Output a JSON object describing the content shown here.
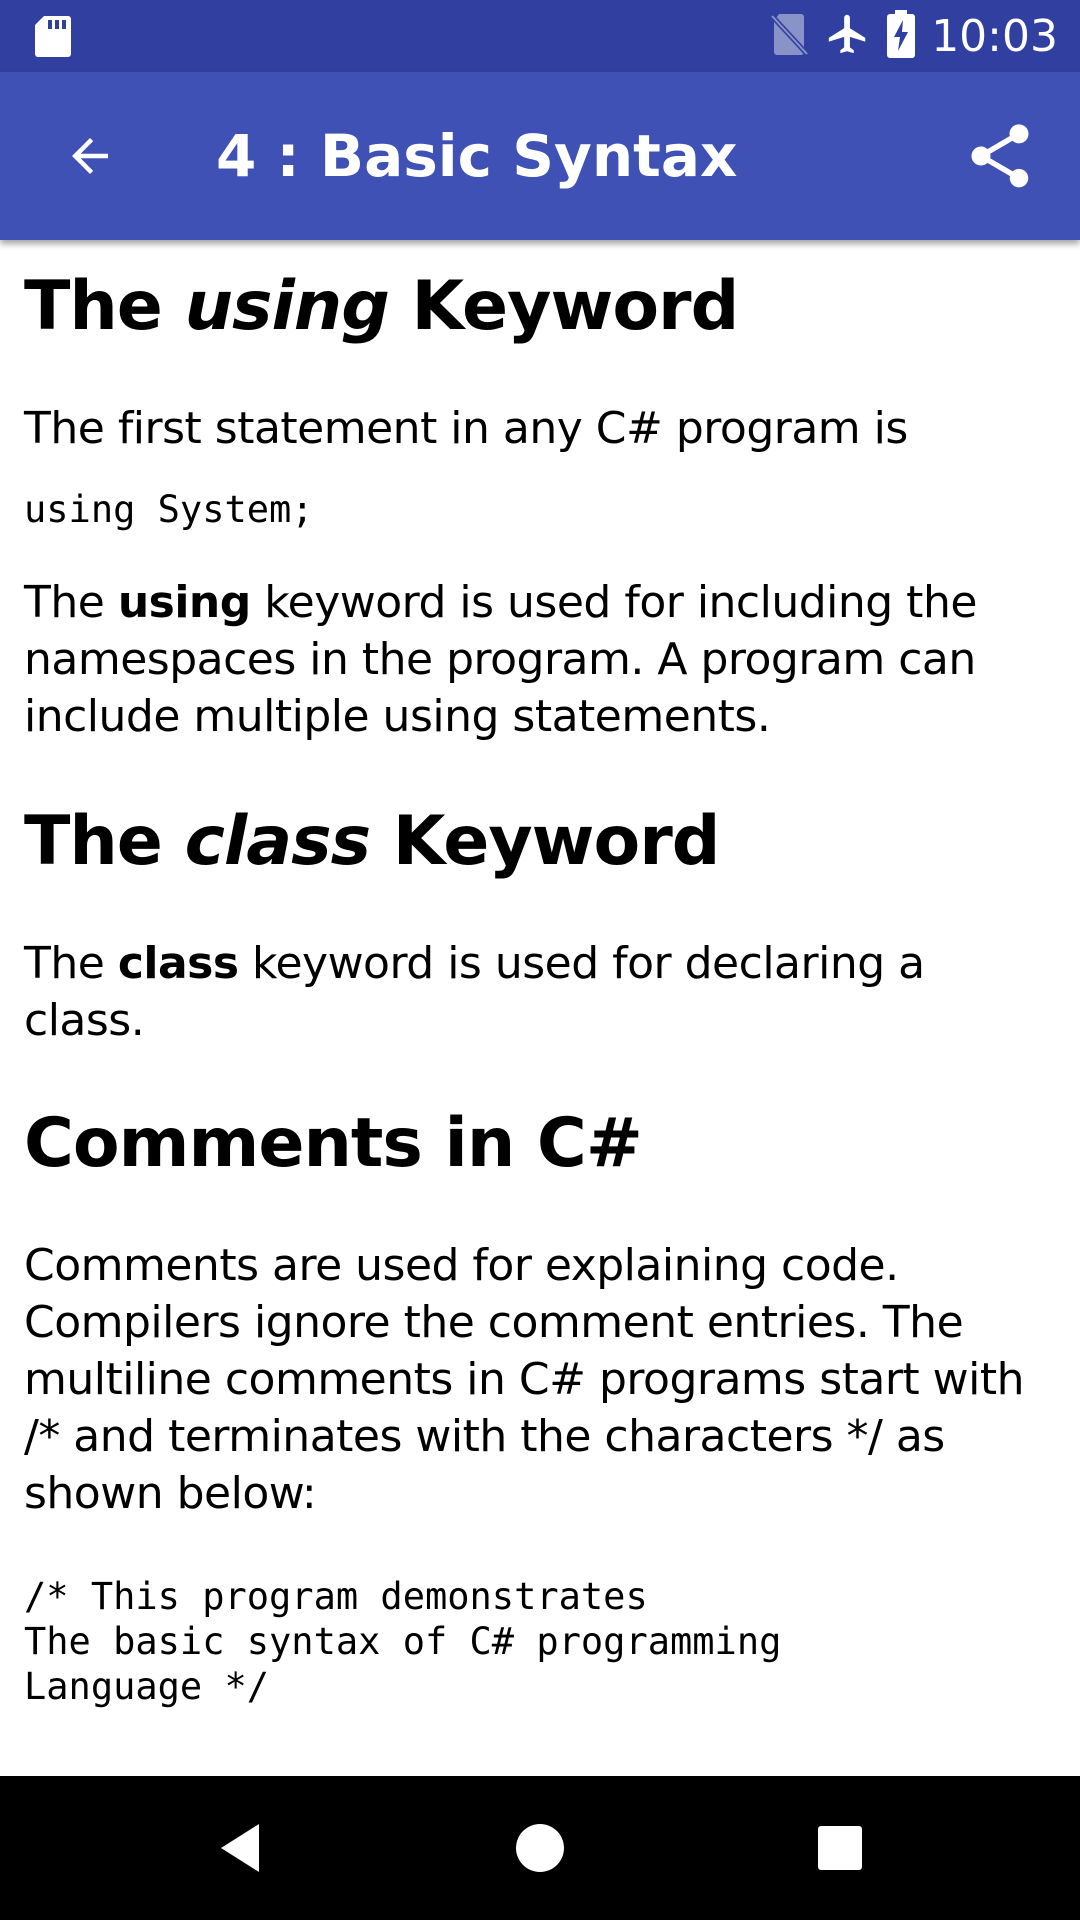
{
  "status_bar": {
    "time": "10:03",
    "icons": [
      "sd-card-icon",
      "no-sim-icon",
      "airplane-mode-icon",
      "battery-charging-icon"
    ]
  },
  "app_bar": {
    "title": "4 : Basic Syntax",
    "back_icon": "arrow-back-icon",
    "share_icon": "share-icon"
  },
  "content": {
    "section1": {
      "heading_pre": "The ",
      "heading_em": "using",
      "heading_post": " Keyword",
      "para1": "The first statement in any C# program is",
      "code": "using System;",
      "para2_pre": "The ",
      "para2_bold": "using",
      "para2_post": " keyword is used for including the namespaces in the program. A program can include multiple using statements."
    },
    "section2": {
      "heading_pre": "The ",
      "heading_em": "class",
      "heading_post": " Keyword",
      "para_pre": "The ",
      "para_bold": "class",
      "para_post": " keyword is used for declaring a class."
    },
    "section3": {
      "heading": "Comments in C#",
      "para": "Comments are used for explaining code. Compilers ignore the comment entries. The multiline comments in C# programs start with /* and terminates with the characters */ as shown below:",
      "code": "/* This program demonstrates\nThe basic syntax of C# programming\nLanguage */"
    }
  },
  "nav_bar": {
    "icons": [
      "nav-back-icon",
      "nav-home-icon",
      "nav-recents-icon"
    ]
  }
}
